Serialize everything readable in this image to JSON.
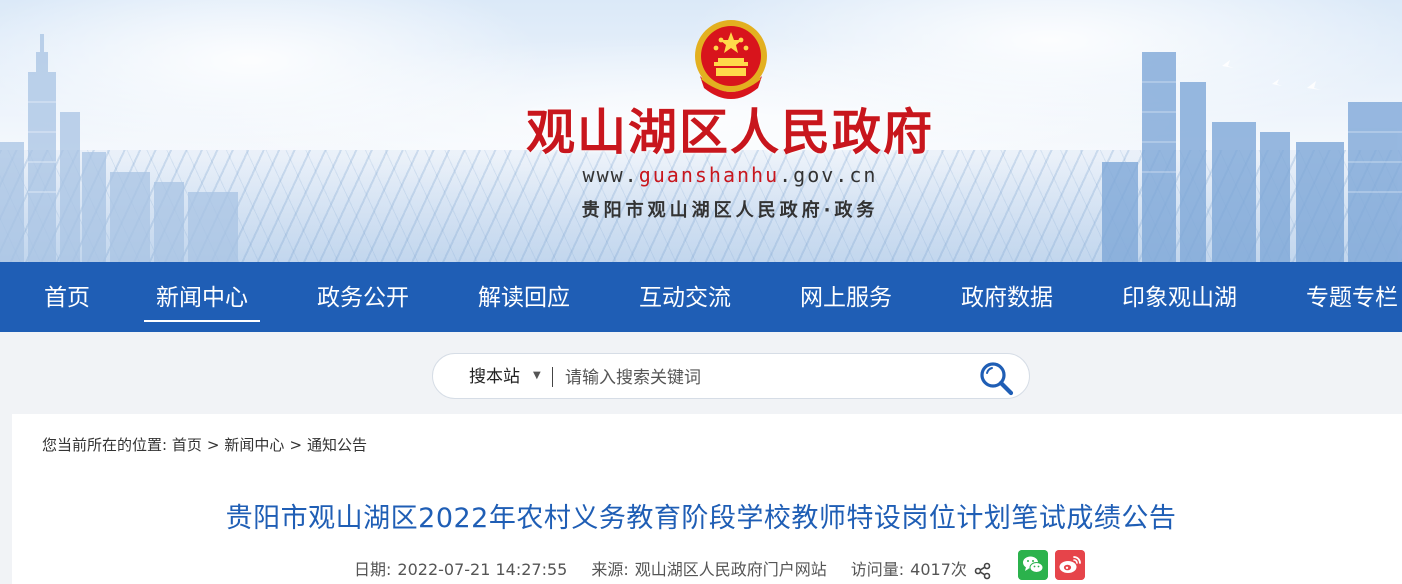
{
  "header": {
    "site_title": "观山湖区人民政府",
    "url_prefix": "www.",
    "url_highlight": "guanshanhu",
    "url_suffix": ".gov.cn",
    "subtitle": "贵阳市观山湖区人民政府·政务"
  },
  "nav": {
    "items": [
      {
        "label": "首页",
        "active": false
      },
      {
        "label": "新闻中心",
        "active": true
      },
      {
        "label": "政务公开",
        "active": false
      },
      {
        "label": "解读回应",
        "active": false
      },
      {
        "label": "互动交流",
        "active": false
      },
      {
        "label": "网上服务",
        "active": false
      },
      {
        "label": "政府数据",
        "active": false
      },
      {
        "label": "印象观山湖",
        "active": false
      },
      {
        "label": "专题专栏",
        "active": false
      }
    ]
  },
  "search": {
    "scope": "搜本站",
    "caret": "▼",
    "placeholder": "请输入搜索关键词",
    "icon": "search-icon"
  },
  "breadcrumb": {
    "prefix": "您当前所在的位置: ",
    "items": [
      "首页",
      "新闻中心",
      "通知公告"
    ],
    "separator": ">"
  },
  "article": {
    "title": "贵阳市观山湖区2022年农村义务教育阶段学校教师特设岗位计划笔试成绩公告",
    "date_label": "日期:",
    "date": "2022-07-21 14:27:55",
    "source_label": "来源:",
    "source": "观山湖区人民政府门户网站",
    "views_label": "访问量:",
    "views": "4017次"
  },
  "share": {
    "icons": [
      "share-icon",
      "wechat-icon",
      "weibo-icon"
    ]
  },
  "colors": {
    "brand_blue": "#1f5eb5",
    "title_red": "#c8161d",
    "wechat_green": "#2bb24c",
    "weibo_red": "#e6444a"
  }
}
